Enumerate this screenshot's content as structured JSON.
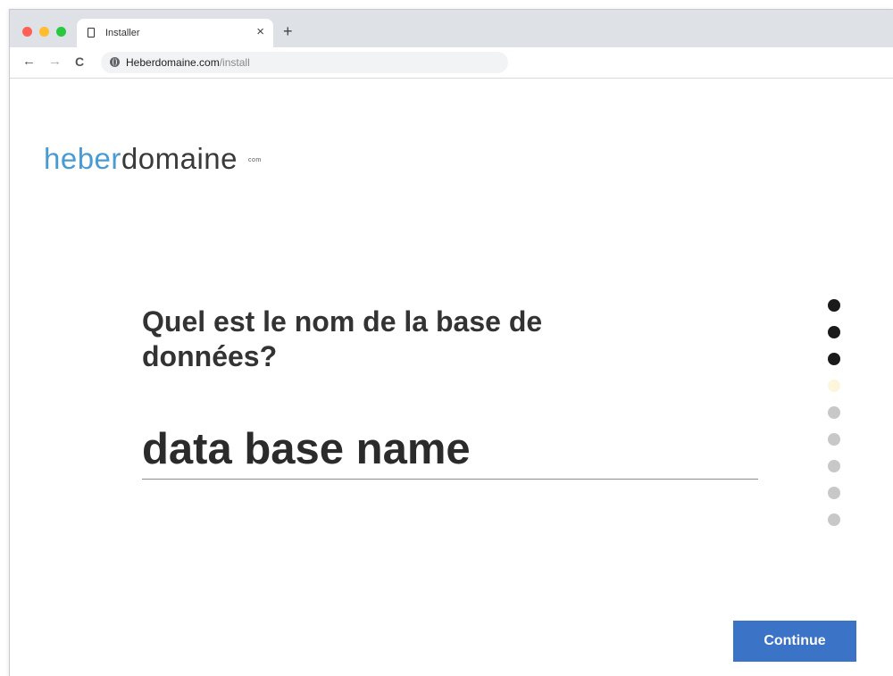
{
  "browser": {
    "tab": {
      "title": "Installer",
      "close": "×"
    },
    "new_tab": "+",
    "nav": {
      "back": "←",
      "forward": "→",
      "reload": "C"
    },
    "url": {
      "host": "Heberdomaine.com",
      "path": "/install"
    },
    "traffic_lights": [
      "#ff5f57",
      "#febc2e",
      "#28c840"
    ]
  },
  "page": {
    "logo": {
      "part1": "heber",
      "part2": "domaine",
      "suffix": "com"
    },
    "question": "Quel est le nom de la base de données?",
    "field": {
      "placeholder": "data base name",
      "value": ""
    },
    "continue_label": "Continue",
    "progress": {
      "total_steps": 9,
      "completed_steps": 3,
      "current_step": 4
    }
  },
  "colors": {
    "logo_accent": "#4a9ad4",
    "logo_dark": "#3a3a3a",
    "button": "#3b73c7",
    "dot_done": "#1a1a1a",
    "dot_current": "#fbf6dc",
    "dot_pending": "#c8c8c8"
  }
}
